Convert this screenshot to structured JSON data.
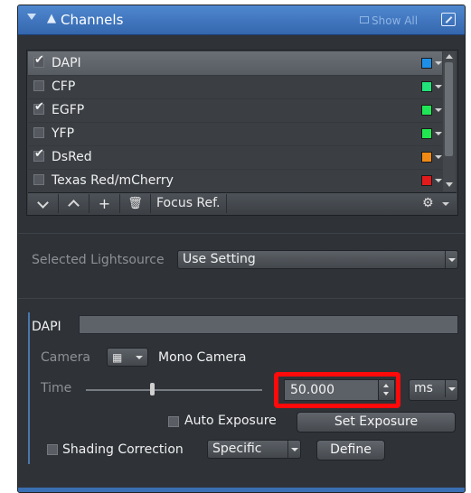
{
  "panel": {
    "title": "Channels",
    "show_all": "Show All"
  },
  "channels": [
    {
      "name": "DAPI",
      "checked": true,
      "color": "#1e8fe6",
      "selected": true
    },
    {
      "name": "CFP",
      "checked": false,
      "color": "#22e27a",
      "selected": false
    },
    {
      "name": "EGFP",
      "checked": true,
      "color": "#1fe657",
      "selected": false
    },
    {
      "name": "YFP",
      "checked": false,
      "color": "#22e650",
      "selected": false
    },
    {
      "name": "DsRed",
      "checked": true,
      "color": "#f08a14",
      "selected": false
    },
    {
      "name": "Texas Red/mCherry",
      "checked": false,
      "color": "#e21a1a",
      "selected": false
    }
  ],
  "list_toolbar": {
    "add": "+",
    "focus_ref": "Focus Ref."
  },
  "lightsource": {
    "label": "Selected Lightsource",
    "value": "Use Setting"
  },
  "channel_settings": {
    "name_label": "DAPI",
    "camera_label": "Camera",
    "camera_name": "Mono Camera",
    "time_label": "Time",
    "time_value": "50.000",
    "time_unit": "ms",
    "auto_exposure_label": "Auto Exposure",
    "set_exposure": "Set Exposure",
    "shading_label": "Shading Correction",
    "shading_mode": "Specific",
    "define": "Define"
  }
}
